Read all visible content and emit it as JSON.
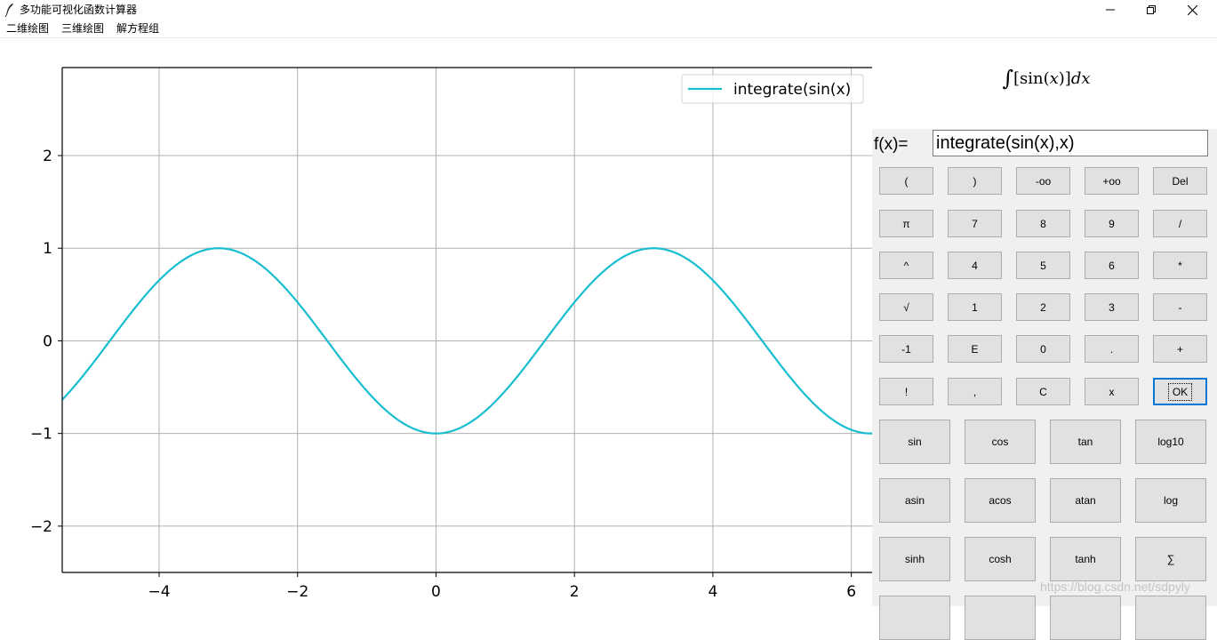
{
  "window": {
    "title": "多功能可视化函数计算器",
    "controls": {
      "minimize": "—",
      "maximize": "❐",
      "close": "✕"
    }
  },
  "menu": [
    {
      "label": "二维绘图"
    },
    {
      "label": "三维绘图"
    },
    {
      "label": "解方程组"
    }
  ],
  "chart_data": {
    "type": "line",
    "title": "",
    "xlabel": "",
    "ylabel": "",
    "xlim": [
      -5.4,
      6.3
    ],
    "ylim": [
      -2.5,
      2.95
    ],
    "xticks": [
      -4,
      -2,
      0,
      2,
      4,
      6
    ],
    "xtick_labels": [
      "−4",
      "−2",
      "0",
      "2",
      "4",
      "6"
    ],
    "yticks": [
      -2,
      -1,
      0,
      1,
      2
    ],
    "ytick_labels": [
      "−2",
      "−1",
      "0",
      "1",
      "2"
    ],
    "grid": true,
    "legend_placement": "top-right",
    "series": [
      {
        "name": "integrate(sin(x)",
        "color": "#17becf",
        "function": "-cos(x)",
        "x": [
          -5.4,
          -5.0,
          -4.5,
          -4.0,
          -3.5,
          -3.14,
          -2.5,
          -2.0,
          -1.5,
          -1.0,
          -0.5,
          0,
          0.5,
          1.0,
          1.5,
          2.0,
          2.5,
          3.14,
          3.5,
          4.0,
          4.5,
          5.0,
          5.5,
          6.0,
          6.28,
          6.3
        ],
        "y": [
          -0.635,
          -0.284,
          0.211,
          0.654,
          0.936,
          1.0,
          0.801,
          0.416,
          -0.071,
          -0.54,
          -0.878,
          -1.0,
          -0.878,
          -0.54,
          -0.071,
          0.416,
          0.801,
          1.0,
          0.936,
          0.654,
          0.211,
          -0.284,
          -0.709,
          -0.96,
          -1.0,
          -1.0
        ]
      }
    ]
  },
  "panel": {
    "formula_lhs": "∫",
    "formula_mid": "[sin(",
    "formula_var": "x",
    "formula_mid2": ")]",
    "formula_dx": "dx",
    "fx_label": "f(x)=",
    "fx_value": "integrate(sin(x),x)",
    "keys": [
      [
        "(",
        ")",
        "-oo",
        "+oo",
        "Del"
      ],
      [
        "π",
        "7",
        "8",
        "9",
        "/"
      ],
      [
        "^",
        "4",
        "5",
        "6",
        "*"
      ],
      [
        "√",
        "1",
        "2",
        "3",
        "-"
      ],
      [
        "-1",
        "E",
        "0",
        ".",
        "+"
      ],
      [
        "!",
        ",",
        "C",
        "x",
        "OK"
      ]
    ],
    "funcs": [
      [
        "sin",
        "cos",
        "tan",
        "log10"
      ],
      [
        "asin",
        "acos",
        "atan",
        "log"
      ],
      [
        "sinh",
        "cosh",
        "tanh",
        "∑"
      ]
    ]
  },
  "watermark": "https://blog.csdn.net/sdpyly"
}
